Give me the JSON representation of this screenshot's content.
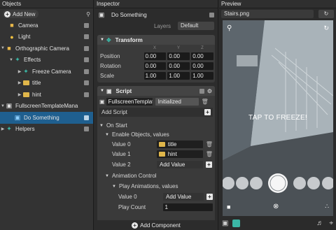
{
  "objects": {
    "title": "Objects",
    "add_new_label": "Add New",
    "items": [
      {
        "label": "Camera",
        "icon": "camera-icon"
      },
      {
        "label": "Light",
        "icon": "light-icon"
      },
      {
        "label": "Orthographic Camera",
        "icon": "orthographic-camera-icon"
      },
      {
        "label": "Effects",
        "icon": "effects-icon"
      },
      {
        "label": "Freeze Camera",
        "icon": "freeze-camera-icon"
      },
      {
        "label": "title",
        "icon": "folder-icon"
      },
      {
        "label": "hint",
        "icon": "folder-icon"
      },
      {
        "label": "FullscreenTemplateMana",
        "icon": "script-icon"
      },
      {
        "label": "Do Something",
        "icon": "behavior-icon"
      },
      {
        "label": "Helpers",
        "icon": "helpers-icon"
      }
    ]
  },
  "inspector": {
    "title": "Inspector",
    "object_name": "Do Something",
    "layers_label": "Layers",
    "layers_value": "Default",
    "transform": {
      "title": "Transform",
      "axes": [
        "X",
        "Y",
        "Z"
      ],
      "rows": [
        {
          "label": "Position",
          "values": [
            "0.00",
            "0.00",
            "0.00"
          ]
        },
        {
          "label": "Rotation",
          "values": [
            "0.00",
            "0.00",
            "0.00"
          ]
        },
        {
          "label": "Scale",
          "values": [
            "1.00",
            "1.00",
            "1.00"
          ]
        }
      ]
    },
    "script": {
      "title": "Script",
      "script_name": "FullscreenTemplate",
      "state": "Initialized",
      "add_script_label": "Add Script"
    },
    "on_start_label": "On Start",
    "enable_objects_label": "Enable Objects, values",
    "values": [
      {
        "label": "Value 0",
        "object": "title"
      },
      {
        "label": "Value 1",
        "object": "hint"
      }
    ],
    "value2_label": "Value 2",
    "add_value_label": "Add Value",
    "animation_control_label": "Animation Control",
    "play_animations_label": "Play Animations, values",
    "anim_value0_label": "Value 0",
    "play_count_label": "Play Count",
    "play_count_value": "1",
    "add_component_label": "Add Component"
  },
  "preview": {
    "title": "Preview",
    "file_name": "Stairs.png",
    "overlay_text": "TAP TO FREEZE!"
  },
  "colors": {
    "selection": "#1f5f8f",
    "accent_teal": "#3bb7a6",
    "folder_yellow": "#e0b64a"
  }
}
